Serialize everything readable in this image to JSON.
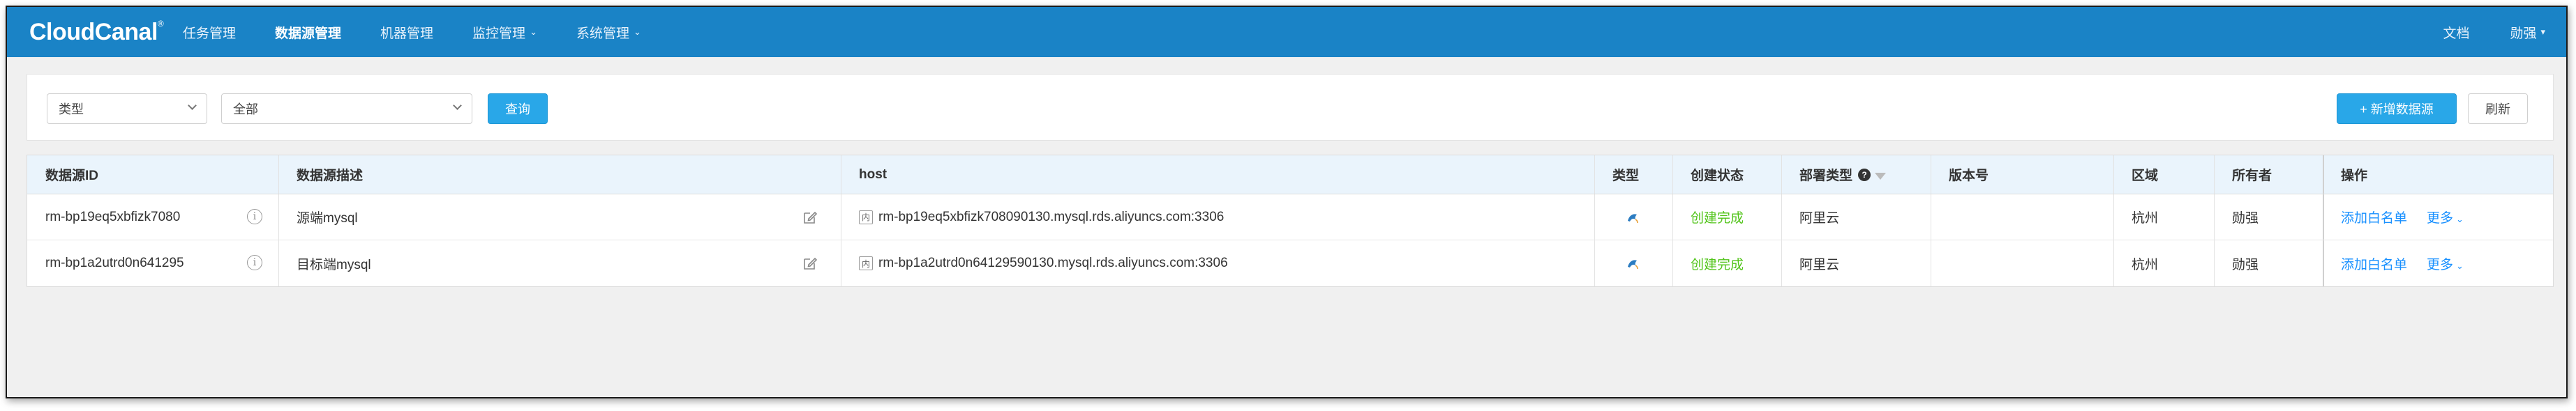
{
  "nav": {
    "logo": "CloudCanal",
    "logo_mark": "®",
    "items": [
      {
        "label": "任务管理",
        "has_menu": false
      },
      {
        "label": "数据源管理",
        "has_menu": false,
        "active": true
      },
      {
        "label": "机器管理",
        "has_menu": false
      },
      {
        "label": "监控管理",
        "has_menu": true
      },
      {
        "label": "系统管理",
        "has_menu": true
      }
    ],
    "docs": "文档",
    "user": "勋强",
    "chevron": "⌄",
    "user_caret": "▾"
  },
  "filters": {
    "type_select": "类型",
    "scope_select": "全部",
    "query_button": "查询",
    "add_button": "+ 新增数据源",
    "refresh_button": "刷新"
  },
  "table": {
    "headers": {
      "id": "数据源ID",
      "desc": "数据源描述",
      "host": "host",
      "type": "类型",
      "create_status": "创建状态",
      "deploy_type": "部署类型",
      "version": "版本号",
      "region": "区域",
      "owner": "所有者",
      "actions": "操作"
    },
    "rows": [
      {
        "id": "rm-bp19eq5xbfizk7080",
        "desc": "源端mysql",
        "host_tag": "内",
        "host": "rm-bp19eq5xbfizk708090130.mysql.rds.aliyuncs.com:3306",
        "type_icon": "mysql-dolphin-icon",
        "create_status": "创建完成",
        "deploy_type": "阿里云",
        "version": "",
        "region": "杭州",
        "owner": "勋强",
        "action_whitelist": "添加白名单",
        "action_more": "更多"
      },
      {
        "id": "rm-bp1a2utrd0n641295",
        "desc": "目标端mysql",
        "host_tag": "内",
        "host": "rm-bp1a2utrd0n64129590130.mysql.rds.aliyuncs.com:3306",
        "type_icon": "mysql-dolphin-icon",
        "create_status": "创建完成",
        "deploy_type": "阿里云",
        "version": "",
        "region": "杭州",
        "owner": "勋强",
        "action_whitelist": "添加白名单",
        "action_more": "更多"
      }
    ]
  },
  "colors": {
    "nav_bg": "#1a83c6",
    "primary": "#29a7e8",
    "link": "#1890ff",
    "success": "#52c41a",
    "header_bg": "#eaf4fc"
  }
}
